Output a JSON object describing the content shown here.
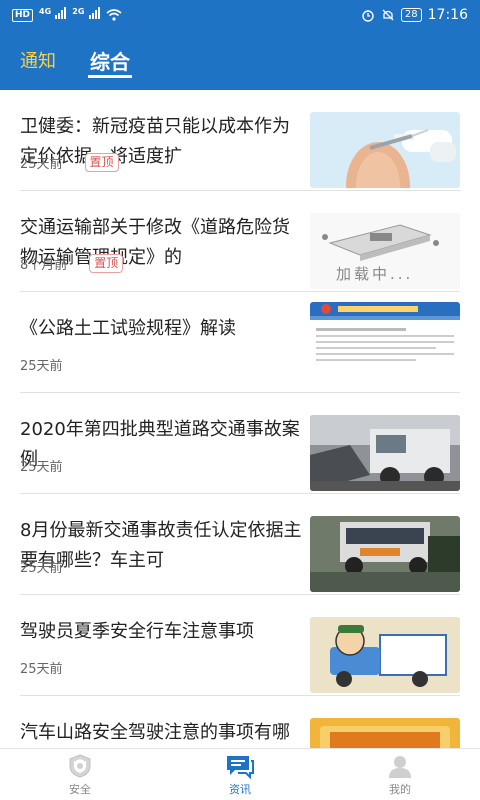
{
  "status_bar": {
    "left_chips": [
      "HD",
      "HD"
    ],
    "signal_tags": [
      "4G",
      "2G"
    ],
    "battery": "28",
    "time": "17:16"
  },
  "tabs": [
    {
      "label": "通知",
      "active": false
    },
    {
      "label": "综合",
      "active": true
    }
  ],
  "feed": [
    {
      "title": "卫健委：新冠疫苗只能以成本作为定价依据，将适度扩",
      "time": "25天前",
      "badge": "置顶",
      "thumb": "vaccine-photo"
    },
    {
      "title": "交通运输部关于修改《道路危险货物运输管理规定》的",
      "time": "8个月前",
      "badge": "置顶",
      "thumb": "loading-placeholder",
      "thumb_text": "加载中..."
    },
    {
      "title": "《公路土工试验规程》解读",
      "time": "25天前",
      "badge": "",
      "thumb": "document-page"
    },
    {
      "title": "2020年第四批典型道路交通事故案例",
      "time": "25天前",
      "badge": "",
      "thumb": "truck-accident-photo"
    },
    {
      "title": "8月份最新交通事故责任认定依据主要有哪些？车主可",
      "time": "25天前",
      "badge": "",
      "thumb": "bus-accident-photo"
    },
    {
      "title": "驾驶员夏季安全行车注意事项",
      "time": "25天前",
      "badge": "",
      "thumb": "cartoon-truck-driver"
    },
    {
      "title": "汽车山路安全驾驶注意的事项有哪些",
      "time": "",
      "badge": "",
      "thumb": "banner-image"
    }
  ],
  "bottom_nav": [
    {
      "label": "安全",
      "icon": "shield-icon",
      "active": false
    },
    {
      "label": "资讯",
      "icon": "news-chat-icon",
      "active": true
    },
    {
      "label": "我的",
      "icon": "user-icon",
      "active": false
    }
  ],
  "colors": {
    "primary": "#1f73c4",
    "tab_inactive": "#ffd23a",
    "badge": "#d9534f"
  }
}
